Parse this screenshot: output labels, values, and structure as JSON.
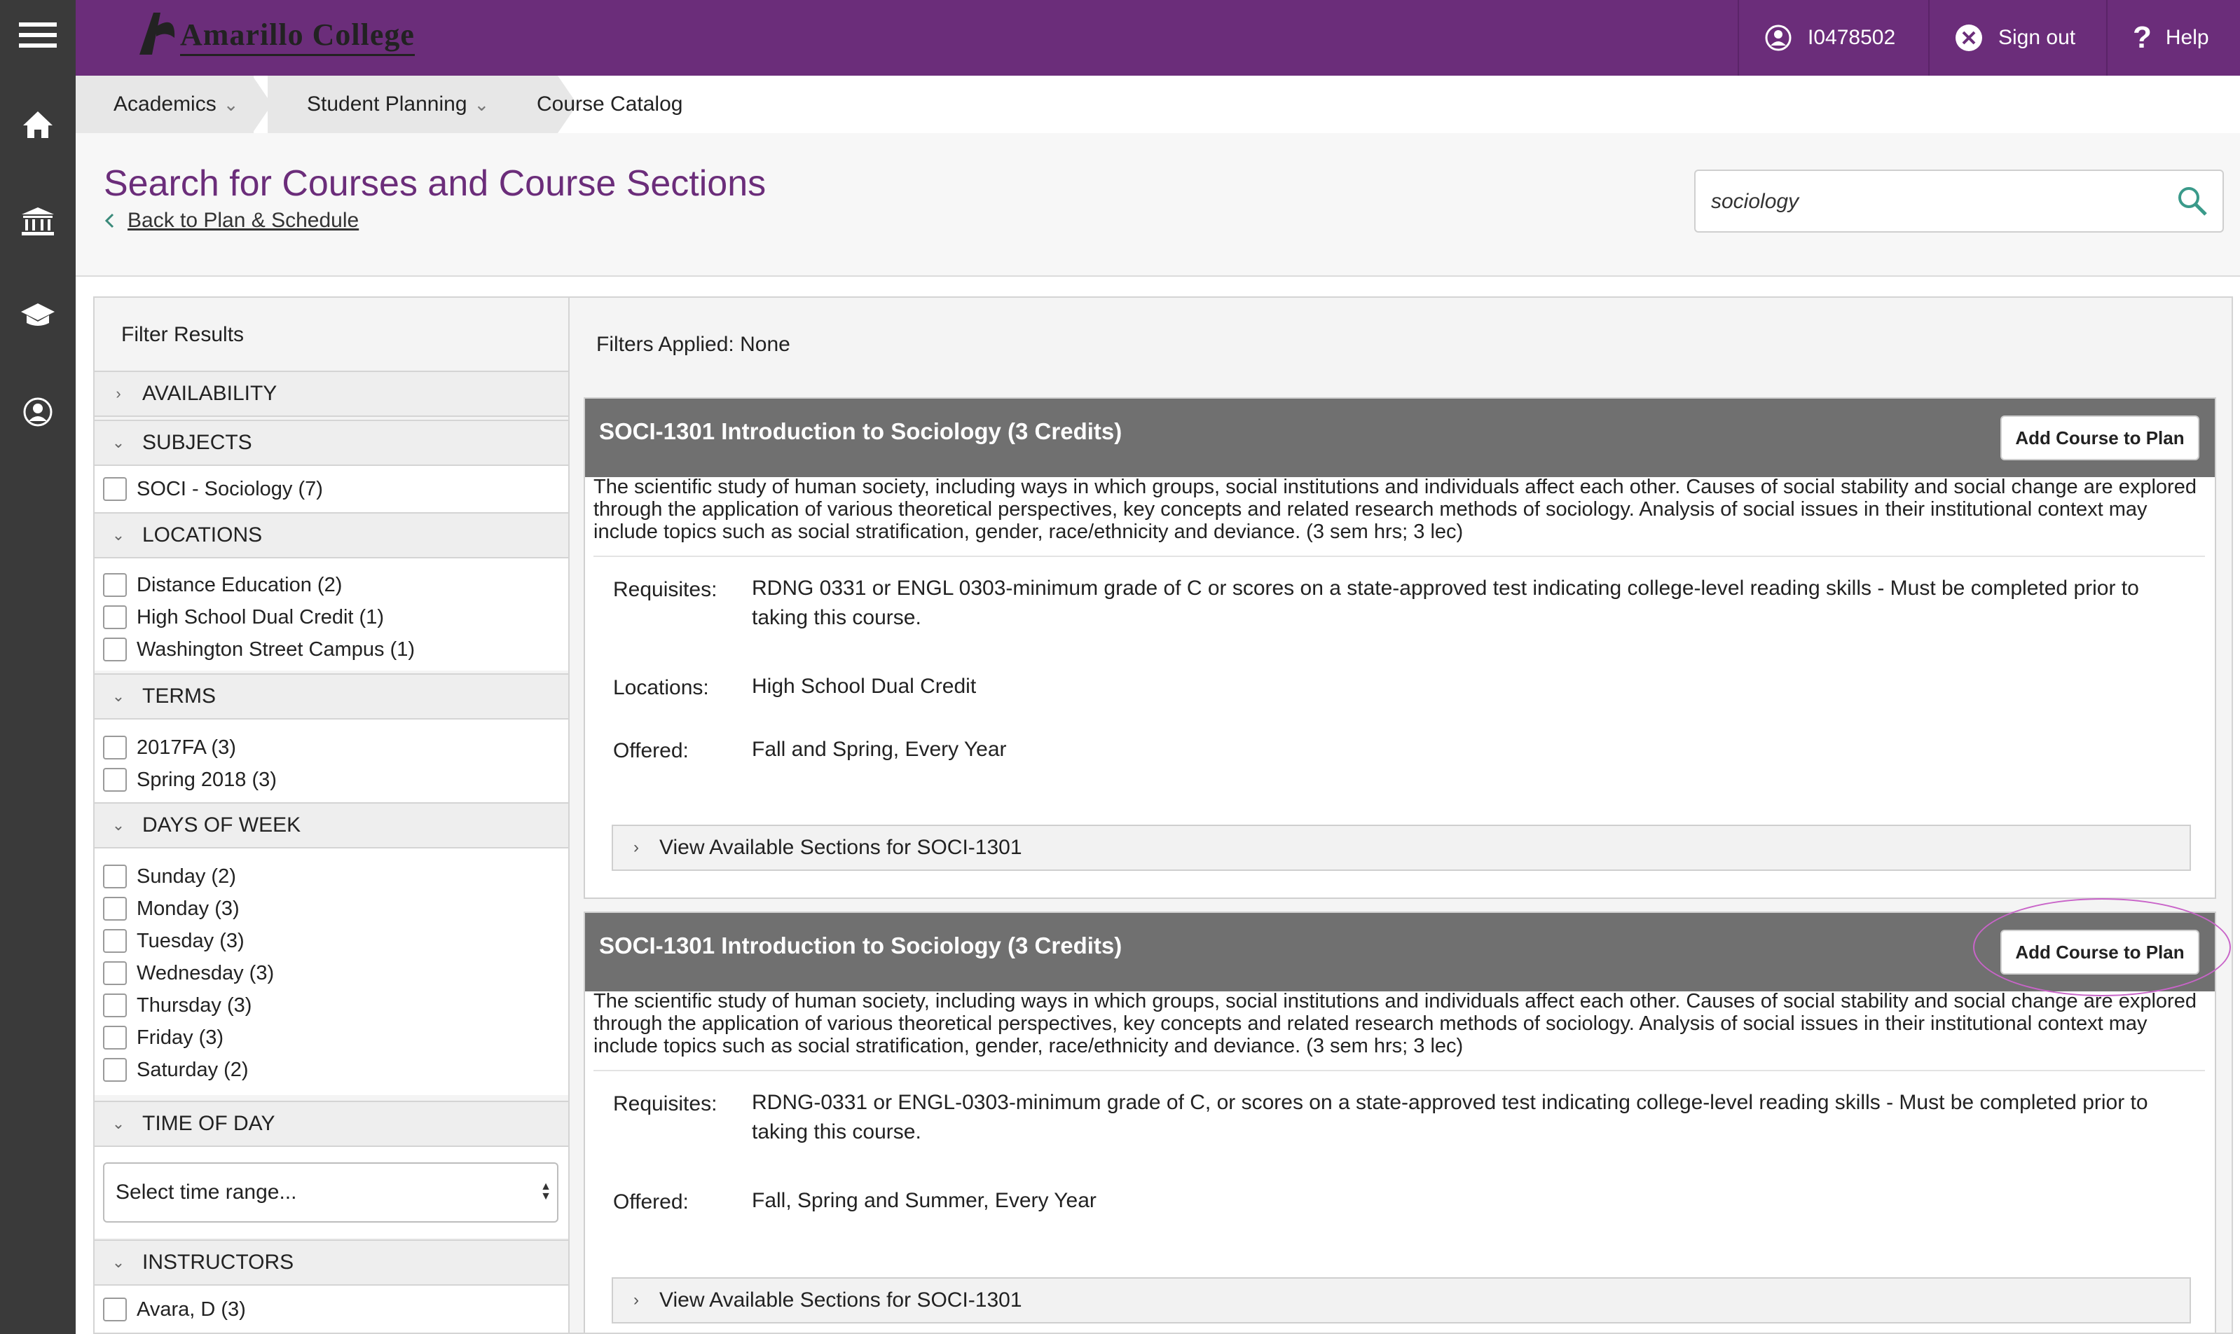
{
  "brand": {
    "logo_text": "Amarillo College",
    "purple": "#6b2d7a",
    "nav_dark": "#3a3a3a"
  },
  "leftnav": {
    "items": [
      "menu-icon",
      "home-icon",
      "institution-icon",
      "graduation-cap-icon",
      "user-profile-icon"
    ]
  },
  "topbar": {
    "user_id": "I0478502",
    "sign_out": "Sign out",
    "help": "Help"
  },
  "breadcrumb": {
    "academics": "Academics",
    "student_planning": "Student Planning",
    "course_catalog": "Course Catalog"
  },
  "page": {
    "title": "Search for Courses and Course Sections",
    "back_link": "Back to Plan & Schedule"
  },
  "search": {
    "value": "sociology"
  },
  "filters": {
    "title": "Filter Results",
    "availability": "AVAILABILITY",
    "subjects": {
      "label": "SUBJECTS",
      "options": [
        "SOCI - Sociology (7)"
      ]
    },
    "locations": {
      "label": "LOCATIONS",
      "options": [
        "Distance Education (2)",
        "High School Dual Credit (1)",
        "Washington Street Campus (1)"
      ]
    },
    "terms": {
      "label": "TERMS",
      "options": [
        "2017FA (3)",
        "Spring 2018 (3)"
      ]
    },
    "days": {
      "label": "DAYS OF WEEK",
      "options": [
        "Sunday (2)",
        "Monday (3)",
        "Tuesday (3)",
        "Wednesday (3)",
        "Thursday (3)",
        "Friday (3)",
        "Saturday (2)"
      ]
    },
    "time_of_day": {
      "label": "TIME OF DAY",
      "select_value": "Select time range..."
    },
    "instructors": {
      "label": "INSTRUCTORS",
      "options": [
        "Avara, D (3)"
      ]
    }
  },
  "results": {
    "filters_applied": "Filters Applied: None",
    "courses": [
      {
        "title": "SOCI-1301 Introduction to Sociology (3 Credits)",
        "add_button": "Add Course to Plan",
        "description": "The scientific study of human society, including ways in which groups, social institutions and individuals affect each other. Causes of social stability and social change are explored through the application of various theoretical perspectives, key concepts and related research methods of sociology. Analysis of social issues in their institutional context may include topics such as social stratification, gender, race/ethnicity and deviance. (3 sem hrs; 3 lec)",
        "requisites_label": "Requisites:",
        "requisites": "RDNG 0331 or ENGL 0303-minimum grade of C or scores on a state-approved test indicating college-level reading skills - Must be completed prior to taking this course.",
        "locations_label": "Locations:",
        "locations": "High School Dual Credit",
        "offered_label": "Offered:",
        "offered": "Fall and Spring, Every Year",
        "view_sections": "View Available Sections for SOCI-1301"
      },
      {
        "title": "SOCI-1301 Introduction to Sociology (3 Credits)",
        "add_button": "Add Course to Plan",
        "description": "The scientific study of human society, including ways in which groups, social institutions and individuals affect each other. Causes of social stability and social change are explored through the application of various theoretical perspectives, key concepts and related research methods of sociology. Analysis of social issues in their institutional context may include topics such as social stratification, gender, race/ethnicity and deviance. (3 sem hrs; 3 lec)",
        "requisites_label": "Requisites:",
        "requisites": "RDNG-0331 or ENGL-0303-minimum grade of C, or scores on a state-approved test indicating college-level reading skills - Must be completed prior to taking this course.",
        "offered_label": "Offered:",
        "offered": "Fall, Spring and Summer, Every Year",
        "view_sections": "View Available Sections for SOCI-1301"
      }
    ]
  }
}
